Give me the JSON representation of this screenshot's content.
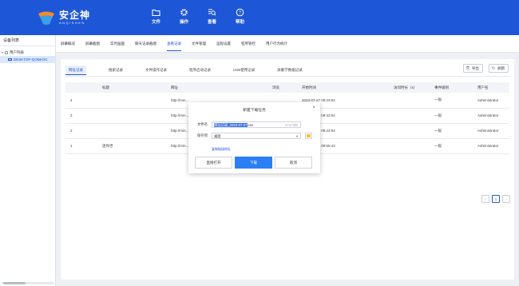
{
  "app": {
    "logo_cn": "安企神",
    "logo_en": "ANQISHEN"
  },
  "nav": [
    {
      "label": "文件",
      "icon": "folder-icon"
    },
    {
      "label": "操作",
      "icon": "gear-icon"
    },
    {
      "label": "查看",
      "icon": "search-list-icon"
    },
    {
      "label": "帮助",
      "icon": "help-icon"
    }
  ],
  "left_panel": {
    "title": "设备列表",
    "tree": [
      {
        "label": "用户列表",
        "expanded": true
      },
      {
        "label": "DESKTOP-QOBKOC"
      }
    ]
  },
  "main_tabs": [
    "屏幕概况",
    "屏幕截图",
    "实时画面",
    "聊天记录截图",
    "查看记录",
    "文件管理",
    "运程设置",
    "程序管控",
    "用户行为统计"
  ],
  "main_tab_active": 4,
  "sub_tabs": [
    "网址记录",
    "搜索记录",
    "文件操作记录",
    "程序启动记录",
    "USB使用记录",
    "屏蔽学数据记录"
  ],
  "sub_tab_active": 0,
  "toolbar": {
    "export": "导出",
    "refresh": "刷新"
  },
  "table": {
    "columns": [
      "",
      "标题",
      "网址",
      "浏览",
      "开始时间",
      "访问时长（s）",
      "事件级别",
      "用户名"
    ],
    "rows": [
      [
        "4",
        "",
        "http://min...",
        "",
        "2023-07-27 09:23:54",
        "",
        "一般",
        "Administrator"
      ],
      [
        "3",
        "",
        "http://min...",
        "",
        "2023-07-27 09:23:54",
        "",
        "一般",
        "Administrator"
      ],
      [
        "2",
        "",
        "http://min...",
        "",
        "2023-07-27 09:23:54",
        "",
        "一般",
        "Administrator"
      ],
      [
        "1",
        "迷你世",
        "http://min...",
        "",
        "2023-07-27 09:55:43",
        "",
        "一般",
        "Administrator"
      ]
    ]
  },
  "pager": {
    "prev": "‹",
    "current": "1",
    "next": "›"
  },
  "dialog": {
    "title": "新建下载任务",
    "close": "×",
    "filename_label": "文件名",
    "filename_value_selected": "网址记录_2023-07-27",
    "filename_value_ext": ".csv",
    "filesize": "374.00B",
    "save_label": "保存到",
    "save_value": "桌面",
    "link": "复制链接地址",
    "btn_open": "直接打开",
    "btn_download": "下载",
    "btn_cancel": "取消"
  },
  "colors": {
    "brand": "#1e56d8",
    "primary_button": "#2b7ff5"
  }
}
